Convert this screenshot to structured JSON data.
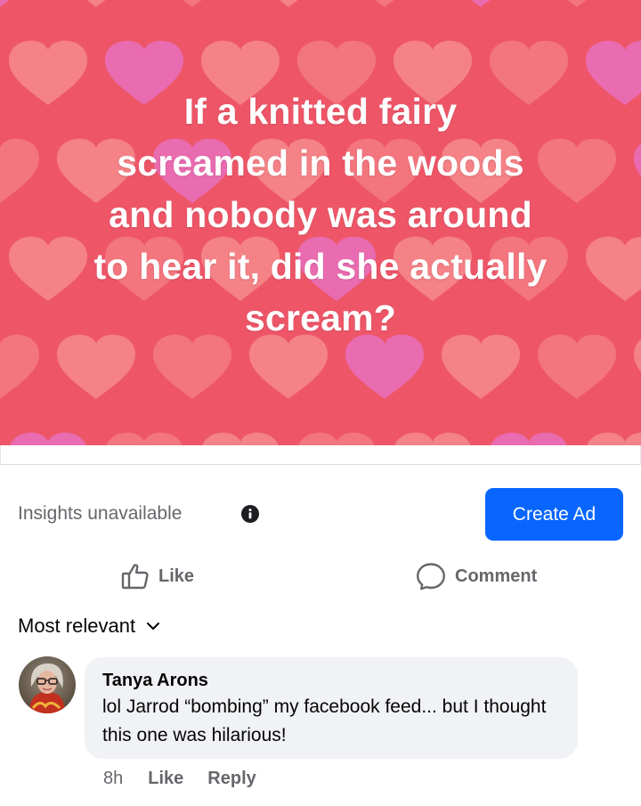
{
  "post": {
    "text": "If a knitted fairy\nscreamed in the woods\nand nobody was around\nto hear it, did she actually\nscream?",
    "background_color": "#ee5668",
    "heart_colors": [
      "#f37a82",
      "#e86fbd",
      "#f48a8c"
    ]
  },
  "insights": {
    "label": "Insights unavailable",
    "icon": "info-icon",
    "create_ad_label": "Create Ad",
    "create_ad_color": "#0866ff"
  },
  "actions": {
    "like_label": "Like",
    "like_icon": "thumbs-up-icon",
    "comment_label": "Comment",
    "comment_icon": "speech-bubble-icon"
  },
  "comments": {
    "sort_label": "Most relevant",
    "sort_icon": "chevron-down-icon",
    "items": [
      {
        "author": "Tanya Arons",
        "text": "lol Jarrod “bombing” my facebook feed... but I thought this one was hilarious!",
        "time": "8h",
        "like_label": "Like",
        "reply_label": "Reply"
      }
    ]
  }
}
